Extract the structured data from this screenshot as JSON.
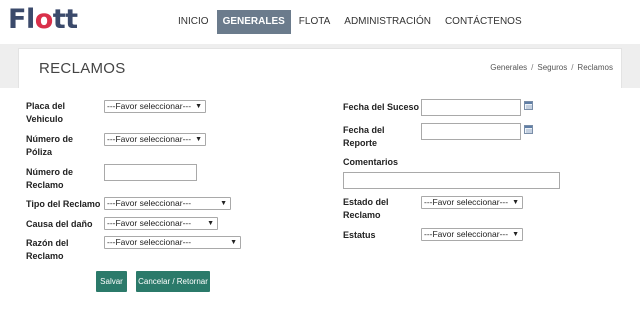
{
  "brand": {
    "logo_prefix": "Fl",
    "logo_o": "o",
    "logo_suffix": "tt"
  },
  "nav": {
    "items": [
      {
        "label": "INICIO",
        "active": false
      },
      {
        "label": "GENERALES",
        "active": true
      },
      {
        "label": "FLOTA",
        "active": false
      },
      {
        "label": "ADMINISTRACIÓN",
        "active": false
      },
      {
        "label": "CONTÁCTENOS",
        "active": false
      }
    ]
  },
  "header": {
    "title": "RECLAMOS",
    "breadcrumb": [
      "Generales",
      "Seguros",
      "Reclamos"
    ],
    "breadcrumb_sep": "/"
  },
  "form": {
    "placa": {
      "label_line1": "Placa del",
      "label_line2": "Vehiculo",
      "value": "---Favor seleccionar---"
    },
    "poliza": {
      "label_line1": "Número de",
      "label_line2": "Póliza",
      "value": "---Favor seleccionar---"
    },
    "reclamo_num": {
      "label_line1": "Número de",
      "label_line2": "Reclamo",
      "value": ""
    },
    "tipo": {
      "label": "Tipo del Reclamo",
      "value": "---Favor seleccionar---"
    },
    "causa": {
      "label": "Causa del daño",
      "value": "---Favor seleccionar---"
    },
    "razon": {
      "label_line1": "Razón del",
      "label_line2": "Reclamo",
      "value": "---Favor seleccionar---"
    },
    "fecha_suceso": {
      "label": "Fecha del Suceso",
      "value": ""
    },
    "fecha_reporte": {
      "label_line1": "Fecha del",
      "label_line2": "Reporte",
      "value": ""
    },
    "comentarios": {
      "label": "Comentarios",
      "value": ""
    },
    "estado": {
      "label_line1": "Estado del",
      "label_line2": "Reclamo",
      "value": "---Favor seleccionar---"
    },
    "estatus": {
      "label": "Estatus",
      "value": "---Favor seleccionar---"
    },
    "caret": "▼"
  },
  "buttons": {
    "save": "Salvar",
    "cancel": "Cancelar / Retornar"
  },
  "colors": {
    "nav_active": "#6b7b8c",
    "button": "#2b7a6a",
    "logo_dark": "#3b4a6b",
    "logo_accent": "#d9304a"
  }
}
